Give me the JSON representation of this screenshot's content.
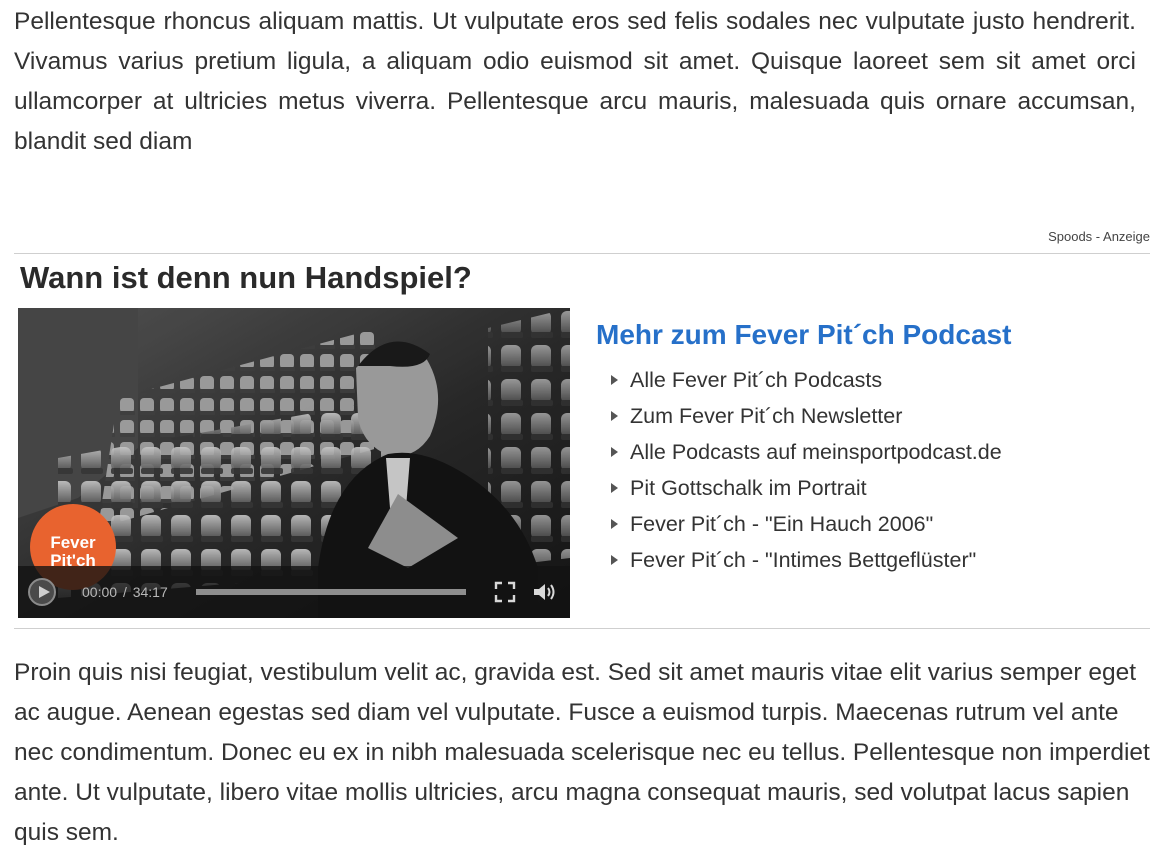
{
  "article": {
    "paragraph_top": "Pellentesque rhoncus aliquam mattis. Ut vulputate eros sed felis sodales nec vulputate justo hendrerit. Vivamus varius pretium ligula, a aliquam odio euismod sit amet. Quisque laoreet sem sit amet orci ullamcorper at ultricies metus viverra. Pellentesque arcu mauris, malesuada quis ornare accumsan, blandit sed diam",
    "paragraph_bottom": "Proin quis nisi feugiat, vestibulum velit ac, gravida est. Sed sit amet mauris vitae elit varius semper eget ac augue. Aenean egestas sed diam vel vulputate. Fusce a euismod turpis. Maecenas rutrum vel ante nec condimentum. Donec eu ex in nibh malesuada scelerisque nec eu tellus. Pellentesque non imperdiet ante. Ut vulputate, libero vitae mollis ultricies, arcu magna consequat mauris, sed volutpat lacus sapien quis sem."
  },
  "ad": {
    "label": "Spoods - Anzeige",
    "title": "Wann ist denn nun Handspiel?"
  },
  "player": {
    "logo_line1": "Fever",
    "logo_line2": "Pit'ch",
    "current_time": "00:00",
    "time_separator": "/",
    "duration": "34:17",
    "progress_fraction": 0,
    "icons": {
      "play": "play-icon",
      "fullscreen": "fullscreen-icon",
      "volume": "volume-icon"
    }
  },
  "sidebar": {
    "title": "Mehr zum Fever Pit´ch Podcast",
    "links": [
      "Alle Fever Pit´ch Podcasts",
      "Zum Fever Pit´ch Newsletter",
      "Alle Podcasts auf meinsportpodcast.de",
      "Pit Gottschalk im Portrait",
      "Fever Pit´ch - \"Ein Hauch 2006\"",
      "Fever Pit´ch - \"Intimes Bettgeflüster\""
    ]
  },
  "colors": {
    "link_title": "#2670c9",
    "text": "#333333",
    "logo": "#e8632f"
  }
}
